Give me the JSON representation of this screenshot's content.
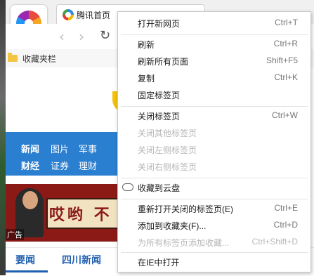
{
  "browser": {
    "tab_title": "腾讯首页",
    "bookmarks_bar_label": "收藏夹栏"
  },
  "page": {
    "nav_row1": [
      "新闻",
      "图片",
      "军事"
    ],
    "nav_row2": [
      "财经",
      "证券",
      "理财"
    ],
    "banner_text": "哎哟 不",
    "ad_label": "广告",
    "bottom_tabs": [
      "要闻",
      "四川新闻"
    ]
  },
  "context_menu": {
    "items": [
      {
        "label": "打开新网页",
        "shortcut": "Ctrl+T",
        "enabled": true
      },
      {
        "label": "刷新",
        "shortcut": "Ctrl+R",
        "enabled": true
      },
      {
        "label": "刷新所有页面",
        "shortcut": "Shift+F5",
        "enabled": true
      },
      {
        "label": "复制",
        "shortcut": "Ctrl+K",
        "enabled": true
      },
      {
        "label": "固定标签页",
        "shortcut": "",
        "enabled": true
      },
      {
        "label": "关闭标签页",
        "shortcut": "Ctrl+W",
        "enabled": true
      },
      {
        "label": "关闭其他标签页",
        "shortcut": "",
        "enabled": false
      },
      {
        "label": "关闭左侧标签页",
        "shortcut": "",
        "enabled": false
      },
      {
        "label": "关闭右侧标签页",
        "shortcut": "",
        "enabled": false
      },
      {
        "label": "收藏到云盘",
        "shortcut": "",
        "enabled": true
      },
      {
        "label": "重新打开关闭的标签页(E)",
        "shortcut": "Ctrl+E",
        "enabled": true
      },
      {
        "label": "添加到收藏夹(F)...",
        "shortcut": "Ctrl+D",
        "enabled": true
      },
      {
        "label": "为所有标签页添加收藏...",
        "shortcut": "Ctrl+Shift+D",
        "enabled": false
      },
      {
        "label": "在IE中打开",
        "shortcut": "",
        "enabled": true
      }
    ]
  },
  "colors": {
    "nav_blue": "#2b7fd0",
    "banner_red": "#8b1a17",
    "link_blue": "#1f5fb0"
  }
}
